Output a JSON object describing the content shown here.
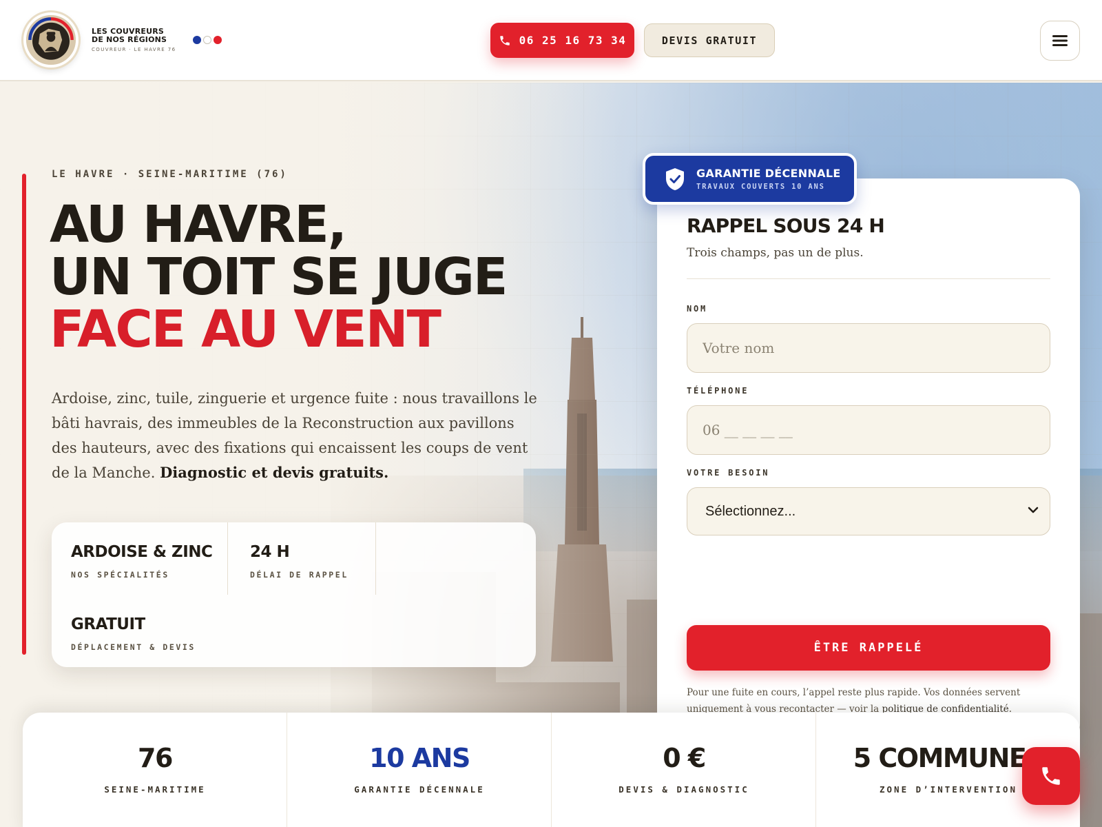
{
  "brand": {
    "line1": "LES COUVREURS",
    "line2": "DE NOS RÉGIONS",
    "tagline": "COUVREUR · LE HAVRE 76",
    "colors": {
      "blue": "#1c3aa0",
      "red": "#e2212b",
      "cream": "#f6f2ea"
    }
  },
  "header": {
    "phone_label": "06 25 16 73 34",
    "phone_icon": "phone-icon",
    "devis_label": "DEVIS GRATUIT",
    "menu_icon": "hamburger-menu-icon"
  },
  "hero": {
    "eyebrow": "LE HAVRE · SEINE-MARITIME (76)",
    "title_line1": "AU HAVRE,",
    "title_line2": "UN TOIT SE JUGE",
    "title_line3": "FACE AU VENT",
    "lead": "Ardoise, zinc, tuile, zinguerie et urgence fuite : nous travaillons le bâti havrais, des immeubles de la Reconstruction aux pavillons des hauteurs, avec des fixations qui encaissent les coups de vent de la Manche.",
    "lead_strong": "Diagnostic et devis gratuits.",
    "specs": [
      {
        "value": "ARDOISE & ZINC",
        "label": "NOS SPÉCIALITÉS"
      },
      {
        "value": "24 H",
        "label": "DÉLAI DE RAPPEL"
      },
      {
        "value": "GRATUIT",
        "label": "DÉPLACEMENT & DEVIS"
      }
    ]
  },
  "form": {
    "badge_title": "GARANTIE DÉCENNALE",
    "badge_sub": "TRAVAUX COUVERTS 10 ANS",
    "badge_icon": "shield-check-icon",
    "title": "RAPPEL SOUS 24 H",
    "subtitle": "Trois champs, pas un de plus.",
    "name_label": "NOM",
    "name_placeholder": "Votre nom",
    "phone_label": "TÉLÉPHONE",
    "phone_placeholder": "06 __ __ __ __",
    "need_label": "VOTRE BESOIN",
    "need_selected": "Sélectionnez...",
    "submit_label": "ÊTRE RAPPELÉ",
    "disclaimer": "Pour une fuite en cours, l’appel reste plus rapide. Vos données servent uniquement à vous recontacter — voir la",
    "privacy_link": "politique de confidentialité",
    "disclaimer_end": "."
  },
  "stats": [
    {
      "value": "76",
      "label": "SEINE-MARITIME"
    },
    {
      "value": "10 ANS",
      "label": "GARANTIE DÉCENNALE"
    },
    {
      "value": "0 €",
      "label": "DEVIS & DIAGNOSTIC"
    },
    {
      "value": "5 COMMUNES",
      "label": "ZONE D’INTERVENTION"
    }
  ],
  "fab": {
    "icon": "phone-icon"
  }
}
